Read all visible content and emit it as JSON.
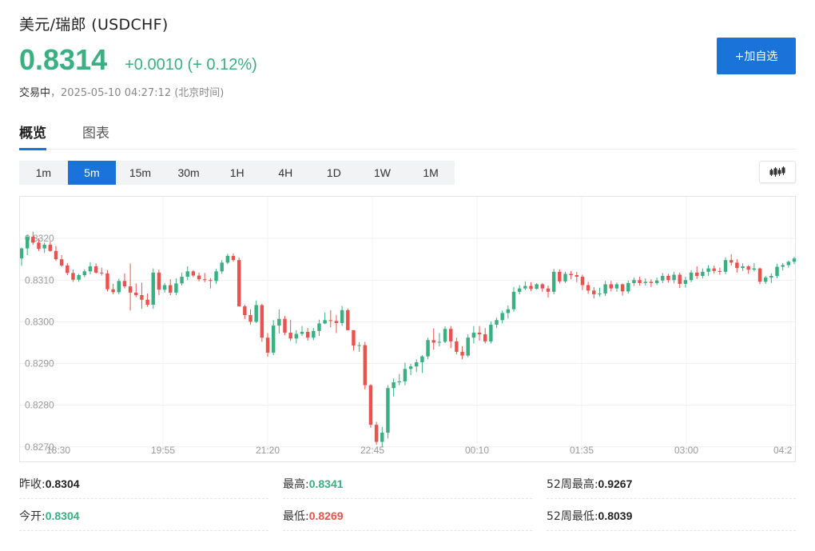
{
  "header": {
    "title": "美元/瑞郎 (USDCHF)",
    "price": "0.8314",
    "change": "+0.0010 (+ 0.12%)",
    "status": "交易中",
    "timestamp": "2025-05-10 04:27:12 (北京时间)",
    "add_watchlist": "+加自选"
  },
  "tabs": [
    {
      "label": "概览",
      "active": true
    },
    {
      "label": "图表",
      "active": false
    }
  ],
  "periods": [
    {
      "label": "1m"
    },
    {
      "label": "5m",
      "active": true
    },
    {
      "label": "15m"
    },
    {
      "label": "30m"
    },
    {
      "label": "1H"
    },
    {
      "label": "4H"
    },
    {
      "label": "1D"
    },
    {
      "label": "1W"
    },
    {
      "label": "1M"
    }
  ],
  "colors": {
    "up": "#3aaf82",
    "down": "#e9534f",
    "accent": "#1a73d9"
  },
  "chart_data": {
    "type": "candlestick",
    "x_ticks": [
      "18:30",
      "19:55",
      "21:20",
      "22:45",
      "00:10",
      "01:35",
      "03:00",
      "04:2"
    ],
    "y_ticks": [
      "0.8270",
      "0.8280",
      "0.8290",
      "0.8300",
      "0.8310",
      "0.8320"
    ],
    "ylim": [
      0.8269,
      0.833
    ],
    "grid": true,
    "candles": [
      [
        0.83152,
        0.83178,
        0.83134,
        0.83176
      ],
      [
        0.83176,
        0.83209,
        0.8316,
        0.83204
      ],
      [
        0.83204,
        0.83216,
        0.83185,
        0.8319
      ],
      [
        0.8319,
        0.832,
        0.8317,
        0.83175
      ],
      [
        0.83176,
        0.8319,
        0.83165,
        0.83185
      ],
      [
        0.83185,
        0.83193,
        0.83168,
        0.8317
      ],
      [
        0.8317,
        0.83182,
        0.83146,
        0.8315
      ],
      [
        0.8315,
        0.8316,
        0.83132,
        0.83135
      ],
      [
        0.83135,
        0.83141,
        0.83112,
        0.83117
      ],
      [
        0.83117,
        0.83125,
        0.83096,
        0.83101
      ],
      [
        0.83101,
        0.83115,
        0.83096,
        0.83112
      ],
      [
        0.83112,
        0.83126,
        0.83107,
        0.83121
      ],
      [
        0.83121,
        0.83143,
        0.83114,
        0.83133
      ],
      [
        0.83133,
        0.8314,
        0.83116,
        0.83118
      ],
      [
        0.83118,
        0.8313,
        0.83111,
        0.83116
      ],
      [
        0.83116,
        0.83124,
        0.83073,
        0.83078
      ],
      [
        0.83078,
        0.83091,
        0.83066,
        0.83071
      ],
      [
        0.83071,
        0.83103,
        0.83066,
        0.83098
      ],
      [
        0.83098,
        0.83116,
        0.8308,
        0.83085
      ],
      [
        0.83085,
        0.8314,
        0.83027,
        0.8307
      ],
      [
        0.8307,
        0.83092,
        0.83059,
        0.83064
      ],
      [
        0.83064,
        0.83094,
        0.83031,
        0.83053
      ],
      [
        0.83053,
        0.83068,
        0.83036,
        0.83041
      ],
      [
        0.83041,
        0.83128,
        0.83031,
        0.83118
      ],
      [
        0.83118,
        0.83125,
        0.83064,
        0.83077
      ],
      [
        0.83077,
        0.83093,
        0.8307,
        0.83088
      ],
      [
        0.83088,
        0.83102,
        0.83064,
        0.8307
      ],
      [
        0.8307,
        0.83104,
        0.83064,
        0.83092
      ],
      [
        0.83092,
        0.83118,
        0.83087,
        0.83108
      ],
      [
        0.83108,
        0.83133,
        0.831,
        0.83121
      ],
      [
        0.83121,
        0.83124,
        0.83107,
        0.83111
      ],
      [
        0.83111,
        0.83118,
        0.83097,
        0.83102
      ],
      [
        0.83102,
        0.83117,
        0.83095,
        0.831
      ],
      [
        0.831,
        0.83105,
        0.8308,
        0.83098
      ],
      [
        0.83098,
        0.83127,
        0.83091,
        0.83121
      ],
      [
        0.83121,
        0.83148,
        0.83115,
        0.83142
      ],
      [
        0.83142,
        0.83163,
        0.83138,
        0.83158
      ],
      [
        0.83158,
        0.83164,
        0.83144,
        0.83148
      ],
      [
        0.83148,
        0.83154,
        0.83037,
        0.83037
      ],
      [
        0.83037,
        0.83041,
        0.83007,
        0.83016
      ],
      [
        0.83016,
        0.8303,
        0.82993,
        0.83
      ],
      [
        0.83,
        0.83051,
        0.82997,
        0.8304
      ],
      [
        0.8304,
        0.83043,
        0.82952,
        0.82962
      ],
      [
        0.82962,
        0.82973,
        0.82916,
        0.82926
      ],
      [
        0.82926,
        0.83004,
        0.8292,
        0.82991
      ],
      [
        0.82991,
        0.8303,
        0.82972,
        0.83007
      ],
      [
        0.83007,
        0.83014,
        0.82968,
        0.82974
      ],
      [
        0.82974,
        0.83005,
        0.82954,
        0.8296
      ],
      [
        0.8296,
        0.8298,
        0.82948,
        0.82971
      ],
      [
        0.82971,
        0.8299,
        0.82966,
        0.82976
      ],
      [
        0.82976,
        0.82985,
        0.82955,
        0.82962
      ],
      [
        0.82962,
        0.82985,
        0.82956,
        0.82978
      ],
      [
        0.82978,
        0.83005,
        0.82966,
        0.82996
      ],
      [
        0.82996,
        0.83022,
        0.82994,
        0.83004
      ],
      [
        0.83004,
        0.83028,
        0.82987,
        0.83002
      ],
      [
        0.83002,
        0.83016,
        0.82973,
        0.82997
      ],
      [
        0.82997,
        0.83038,
        0.8299,
        0.83028
      ],
      [
        0.83028,
        0.83032,
        0.8298,
        0.8298
      ],
      [
        0.8298,
        0.8298,
        0.82931,
        0.82943
      ],
      [
        0.82943,
        0.82951,
        0.82928,
        0.82944
      ],
      [
        0.82944,
        0.82952,
        0.82838,
        0.82848
      ],
      [
        0.82848,
        0.8285,
        0.82746,
        0.82753
      ],
      [
        0.82753,
        0.8276,
        0.82705,
        0.82712
      ],
      [
        0.82712,
        0.82748,
        0.827,
        0.82734
      ],
      [
        0.82734,
        0.82848,
        0.8272,
        0.82841
      ],
      [
        0.82841,
        0.82864,
        0.82821,
        0.82855
      ],
      [
        0.82855,
        0.82875,
        0.82848,
        0.82857
      ],
      [
        0.82857,
        0.82902,
        0.82848,
        0.82887
      ],
      [
        0.82887,
        0.82899,
        0.82872,
        0.82893
      ],
      [
        0.82893,
        0.8291,
        0.8288,
        0.82903
      ],
      [
        0.82903,
        0.8292,
        0.82877,
        0.82917
      ],
      [
        0.82917,
        0.82962,
        0.8291,
        0.82956
      ],
      [
        0.82956,
        0.82984,
        0.82933,
        0.8295
      ],
      [
        0.8295,
        0.82973,
        0.82941,
        0.82952
      ],
      [
        0.82952,
        0.82989,
        0.82949,
        0.82983
      ],
      [
        0.82983,
        0.8299,
        0.82937,
        0.82953
      ],
      [
        0.82953,
        0.82962,
        0.82922,
        0.82928
      ],
      [
        0.82928,
        0.82941,
        0.8291,
        0.82919
      ],
      [
        0.82919,
        0.8297,
        0.82915,
        0.82962
      ],
      [
        0.82962,
        0.8299,
        0.82948,
        0.82974
      ],
      [
        0.82974,
        0.8299,
        0.82955,
        0.8297
      ],
      [
        0.8297,
        0.82985,
        0.82948,
        0.82953
      ],
      [
        0.82953,
        0.83001,
        0.82948,
        0.82993
      ],
      [
        0.82993,
        0.8301,
        0.82985,
        0.83004
      ],
      [
        0.83004,
        0.83027,
        0.82996,
        0.83021
      ],
      [
        0.83021,
        0.83039,
        0.83008,
        0.8303
      ],
      [
        0.8303,
        0.83083,
        0.83024,
        0.83072
      ],
      [
        0.83072,
        0.83088,
        0.83066,
        0.8308
      ],
      [
        0.8308,
        0.83097,
        0.83076,
        0.83086
      ],
      [
        0.83086,
        0.83095,
        0.83074,
        0.83079
      ],
      [
        0.83079,
        0.83093,
        0.83077,
        0.8309
      ],
      [
        0.8309,
        0.83093,
        0.83072,
        0.8308
      ],
      [
        0.8308,
        0.83087,
        0.83058,
        0.83072
      ],
      [
        0.83072,
        0.83127,
        0.83066,
        0.8312
      ],
      [
        0.8312,
        0.83126,
        0.83092,
        0.83097
      ],
      [
        0.83097,
        0.8312,
        0.83093,
        0.83115
      ],
      [
        0.83115,
        0.83122,
        0.83102,
        0.83112
      ],
      [
        0.83112,
        0.8312,
        0.83095,
        0.83108
      ],
      [
        0.83108,
        0.83113,
        0.83076,
        0.83088
      ],
      [
        0.83088,
        0.83096,
        0.83067,
        0.83075
      ],
      [
        0.83075,
        0.83083,
        0.83056,
        0.83066
      ],
      [
        0.83066,
        0.83082,
        0.8306,
        0.83068
      ],
      [
        0.83068,
        0.83098,
        0.83062,
        0.8309
      ],
      [
        0.8309,
        0.83098,
        0.83073,
        0.8308
      ],
      [
        0.8308,
        0.83094,
        0.83072,
        0.8309
      ],
      [
        0.8309,
        0.83092,
        0.83063,
        0.83073
      ],
      [
        0.83073,
        0.83099,
        0.83068,
        0.83093
      ],
      [
        0.83093,
        0.83106,
        0.83086,
        0.831
      ],
      [
        0.831,
        0.83108,
        0.83087,
        0.83093
      ],
      [
        0.83093,
        0.83104,
        0.83087,
        0.83096
      ],
      [
        0.83096,
        0.83102,
        0.83083,
        0.83093
      ],
      [
        0.83093,
        0.83106,
        0.83088,
        0.83099
      ],
      [
        0.83099,
        0.83117,
        0.83093,
        0.8311
      ],
      [
        0.8311,
        0.83115,
        0.83094,
        0.831
      ],
      [
        0.831,
        0.8312,
        0.83092,
        0.83113
      ],
      [
        0.83113,
        0.83118,
        0.83081,
        0.83091
      ],
      [
        0.83091,
        0.83108,
        0.83082,
        0.831
      ],
      [
        0.831,
        0.83124,
        0.83095,
        0.83118
      ],
      [
        0.83118,
        0.83133,
        0.83103,
        0.8311
      ],
      [
        0.8311,
        0.83128,
        0.83104,
        0.8312
      ],
      [
        0.8312,
        0.83136,
        0.8311,
        0.83128
      ],
      [
        0.83128,
        0.83135,
        0.83115,
        0.83122
      ],
      [
        0.83122,
        0.8313,
        0.83113,
        0.8312
      ],
      [
        0.8312,
        0.83155,
        0.83114,
        0.83148
      ],
      [
        0.83148,
        0.83162,
        0.83135,
        0.83142
      ],
      [
        0.83142,
        0.8315,
        0.83118,
        0.83129
      ],
      [
        0.83129,
        0.8314,
        0.83122,
        0.83133
      ],
      [
        0.83133,
        0.83136,
        0.83115,
        0.83125
      ],
      [
        0.83125,
        0.83141,
        0.83121,
        0.83128
      ],
      [
        0.83128,
        0.8313,
        0.8309,
        0.83096
      ],
      [
        0.83096,
        0.8311,
        0.83091,
        0.83106
      ],
      [
        0.83106,
        0.83116,
        0.83093,
        0.8311
      ],
      [
        0.8311,
        0.83139,
        0.83105,
        0.83132
      ],
      [
        0.83132,
        0.83141,
        0.83123,
        0.83136
      ],
      [
        0.83136,
        0.83147,
        0.8313,
        0.83144
      ],
      [
        0.83144,
        0.83156,
        0.83138,
        0.83152
      ]
    ]
  },
  "stats": [
    {
      "label": "昨收:",
      "value": "0.8304",
      "tone": "dark"
    },
    {
      "label": "最高:",
      "value": "0.8341",
      "tone": "green"
    },
    {
      "label": "52周最高:",
      "value": "0.9267",
      "tone": "dark"
    },
    {
      "label": "今开:",
      "value": "0.8304",
      "tone": "green"
    },
    {
      "label": "最低:",
      "value": "0.8269",
      "tone": "red"
    },
    {
      "label": "52周最低:",
      "value": "0.8039",
      "tone": "dark"
    }
  ]
}
